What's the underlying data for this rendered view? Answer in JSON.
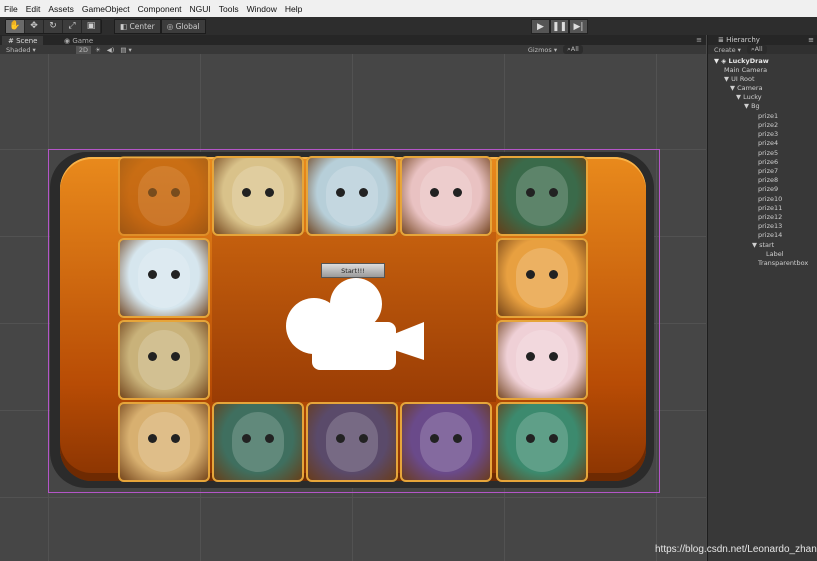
{
  "menu": [
    "File",
    "Edit",
    "Assets",
    "GameObject",
    "Component",
    "NGUI",
    "Tools",
    "Window",
    "Help"
  ],
  "toolbar": {
    "center_label": "Center",
    "global_label": "Global"
  },
  "tabs": {
    "scene": "Scene",
    "game": "Game",
    "hierarchy": "Hierarchy"
  },
  "scene_options": {
    "shading": "Shaded",
    "mode_2d": "2D",
    "gizmos": "Gizmos",
    "search": "All"
  },
  "hierarchy": {
    "create_label": "Create",
    "search": "All",
    "items": [
      {
        "label": "LuckyDraw",
        "bold": true
      },
      {
        "label": "Main Camera"
      },
      {
        "label": "UI Root"
      },
      {
        "label": "Camera"
      },
      {
        "label": "Lucky"
      },
      {
        "label": "Bg"
      },
      {
        "label": "prize1"
      },
      {
        "label": "prize2"
      },
      {
        "label": "prize3"
      },
      {
        "label": "prize4"
      },
      {
        "label": "prize5"
      },
      {
        "label": "prize6"
      },
      {
        "label": "prize7"
      },
      {
        "label": "prize8"
      },
      {
        "label": "prize9"
      },
      {
        "label": "prize10"
      },
      {
        "label": "prize11"
      },
      {
        "label": "prize12"
      },
      {
        "label": "prize13"
      },
      {
        "label": "prize14"
      },
      {
        "label": "start"
      },
      {
        "label": "Label"
      },
      {
        "label": "Transparentbox"
      }
    ]
  },
  "game": {
    "start_label": "Start!!!",
    "tiles": [
      {
        "animal": "monkey-faded",
        "color": "#b25a10"
      },
      {
        "animal": "rooster",
        "color": "#d9c28a"
      },
      {
        "animal": "dog-husky",
        "color": "#b7cfd9"
      },
      {
        "animal": "pig",
        "color": "#e9c2c2"
      },
      {
        "animal": "ox",
        "color": "#3a6a4a"
      },
      {
        "animal": "mouse",
        "color": "#d6e6ee"
      },
      {
        "animal": "tiger",
        "color": "#e8a040"
      },
      {
        "animal": "rooster",
        "color": "#c9b27a"
      },
      {
        "animal": "rabbit",
        "color": "#efd0d6"
      },
      {
        "animal": "monkey",
        "color": "#d8b070"
      },
      {
        "animal": "sheep",
        "color": "#3f6f5f"
      },
      {
        "animal": "horse",
        "color": "#5a4a6a"
      },
      {
        "animal": "snake",
        "color": "#6a4a8a"
      },
      {
        "animal": "dragon",
        "color": "#3c8a6e"
      }
    ]
  },
  "watermark": "https://blog.csdn.net/Leonardo_zhang"
}
